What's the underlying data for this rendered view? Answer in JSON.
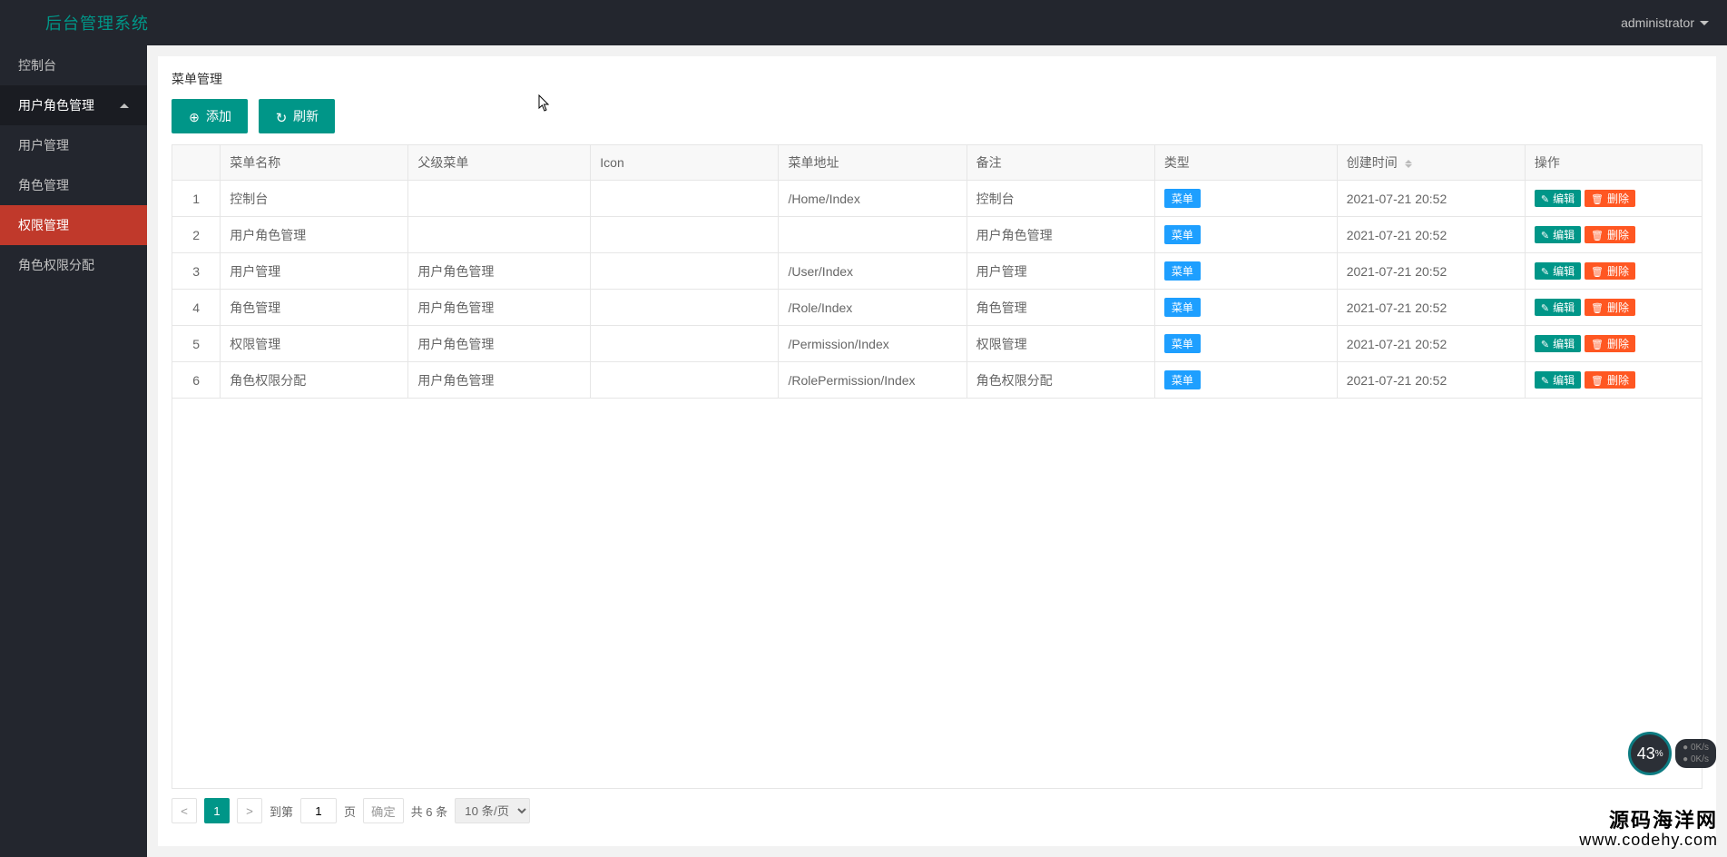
{
  "app": {
    "brand": "后台管理系统",
    "user": "administrator"
  },
  "sidebar": {
    "items": [
      {
        "label": "控制台"
      },
      {
        "label": "用户角色管理",
        "expanded": true
      },
      {
        "label": "用户管理"
      },
      {
        "label": "角色管理"
      },
      {
        "label": "权限管理",
        "active": true
      },
      {
        "label": "角色权限分配"
      }
    ]
  },
  "page": {
    "title": "菜单管理"
  },
  "toolbar": {
    "add": "添加",
    "refresh": "刷新"
  },
  "table": {
    "headers": {
      "idx": "",
      "name": "菜单名称",
      "parent": "父级菜单",
      "icon": "Icon",
      "url": "菜单地址",
      "remark": "备注",
      "type": "类型",
      "time": "创建时间",
      "op": "操作"
    },
    "type_tag": "菜单",
    "edit_label": "编辑",
    "del_label": "删除",
    "rows": [
      {
        "idx": "1",
        "name": "控制台",
        "parent": "",
        "icon": "",
        "url": "/Home/Index",
        "remark": "控制台",
        "time": "2021-07-21 20:52"
      },
      {
        "idx": "2",
        "name": "用户角色管理",
        "parent": "",
        "icon": "",
        "url": "",
        "remark": "用户角色管理",
        "time": "2021-07-21 20:52"
      },
      {
        "idx": "3",
        "name": "用户管理",
        "parent": "用户角色管理",
        "icon": "",
        "url": "/User/Index",
        "remark": "用户管理",
        "time": "2021-07-21 20:52"
      },
      {
        "idx": "4",
        "name": "角色管理",
        "parent": "用户角色管理",
        "icon": "",
        "url": "/Role/Index",
        "remark": "角色管理",
        "time": "2021-07-21 20:52"
      },
      {
        "idx": "5",
        "name": "权限管理",
        "parent": "用户角色管理",
        "icon": "",
        "url": "/Permission/Index",
        "remark": "权限管理",
        "time": "2021-07-21 20:52"
      },
      {
        "idx": "6",
        "name": "角色权限分配",
        "parent": "用户角色管理",
        "icon": "",
        "url": "/RolePermission/Index",
        "remark": "角色权限分配",
        "time": "2021-07-21 20:52"
      }
    ]
  },
  "pager": {
    "current": "1",
    "goto_prefix": "到第",
    "goto_value": "1",
    "goto_suffix": "页",
    "confirm": "确定",
    "total": "共 6 条",
    "pagesize": "10 条/页"
  },
  "floaty": {
    "pct": "43",
    "unit": "%",
    "up": "0K/s",
    "down": "0K/s"
  },
  "watermark": {
    "line1": "源码海洋网",
    "line2": "www.codehy.com"
  }
}
